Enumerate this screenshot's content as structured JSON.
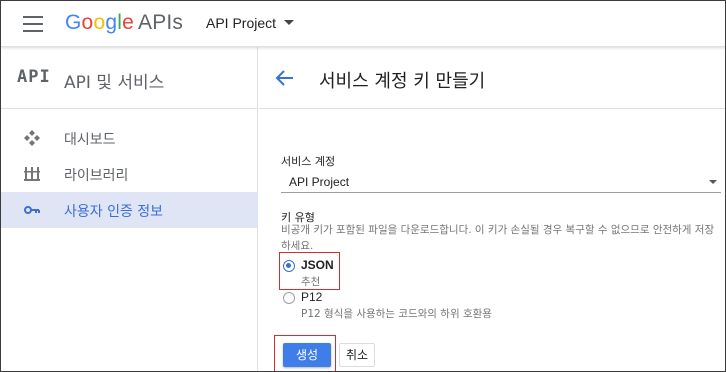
{
  "topbar": {
    "logo_google": [
      "G",
      "o",
      "o",
      "g",
      "l",
      "e"
    ],
    "logo_apis": "APIs",
    "project_name": "API Project"
  },
  "sidebar": {
    "mark": "API",
    "title": "API 및 서비스",
    "items": [
      {
        "label": "대시보드",
        "icon": "dashboard-icon"
      },
      {
        "label": "라이브러리",
        "icon": "library-icon"
      },
      {
        "label": "사용자 인증 정보",
        "icon": "key-icon",
        "active": true
      }
    ]
  },
  "main": {
    "title": "서비스 계정 키 만들기",
    "service_account_label": "서비스 계정",
    "service_account_value": "API Project",
    "key_type_label": "키 유형",
    "key_type_help": "비공개 키가 포함된 파일을 다운로드합니다. 이 키가 손실될 경우 복구할 수 없으므로 안전하게 저장하세요.",
    "options": [
      {
        "label": "JSON",
        "sub": "추천",
        "checked": true
      },
      {
        "label": "P12",
        "sub": "P12 형식을 사용하는 코드와의 하위 호환용",
        "checked": false
      }
    ],
    "create_label": "생성",
    "cancel_label": "취소"
  },
  "colors": {
    "accent": "#3f7ee8",
    "active_bg": "#dfe5f5",
    "highlight": "#d32f2f"
  }
}
